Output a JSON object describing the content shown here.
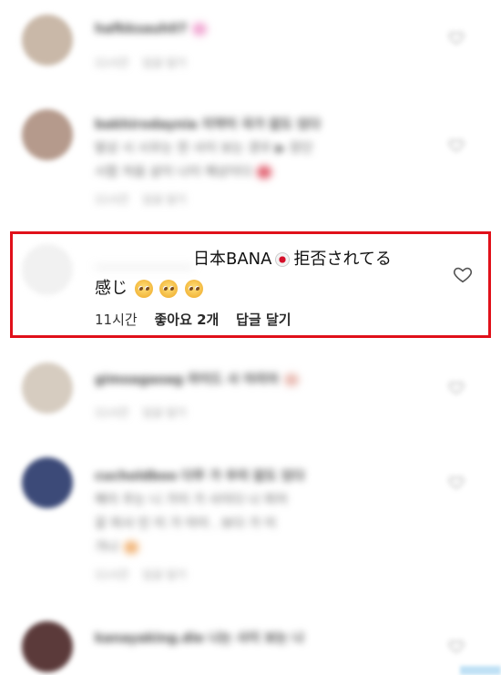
{
  "highlighted_comment": {
    "username": "._____",
    "text_line1": "日本BANA",
    "text_line1_end": "拒否されてる",
    "text_line2": "感じ",
    "emojis": [
      "pleading-face",
      "pleading-face",
      "pleading-face"
    ],
    "time": "11시간",
    "likes": "좋아요 2개",
    "reply": "답글 달기",
    "flag": "japan-flag",
    "highlight_color": "#e0101a"
  },
  "colors": {
    "text": "#111111",
    "meta": "#333333",
    "blurred": "#6c6c6c"
  }
}
